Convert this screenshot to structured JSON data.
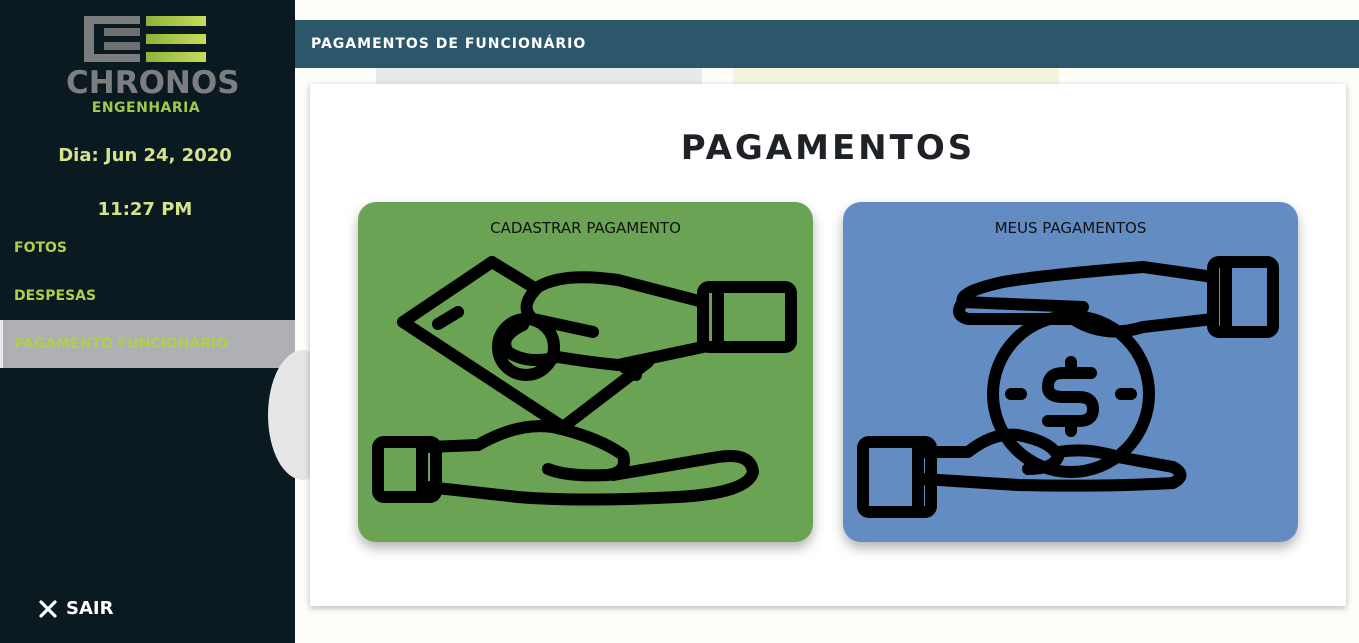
{
  "sidebar": {
    "logo_title": "CHRONOS",
    "logo_subtitle": "ENGENHARIA",
    "date": "Dia: Jun 24, 2020",
    "time": "11:27 PM",
    "nav_items": [
      {
        "label": "FOTOS",
        "active": false
      },
      {
        "label": "DESPESAS",
        "active": false
      },
      {
        "label": "PAGAMENTO FUNCIONÁRIO",
        "active": true
      }
    ],
    "logout_label": "SAIR"
  },
  "header": {
    "title": "PAGAMENTOS DE FUNCIONÁRIO"
  },
  "main": {
    "title": "PAGAMENTOS",
    "cards": [
      {
        "label": "CADASTRAR PAGAMENTO",
        "color": "#6ba354",
        "icon": "money-exchange-hands-icon"
      },
      {
        "label": "MEUS PAGAMENTOS",
        "color": "#638cc3",
        "icon": "coin-between-hands-icon"
      }
    ]
  },
  "colors": {
    "sidebar_bg": "#0b1921",
    "accent_green": "#b3cd4c",
    "header_bg": "#2c576b",
    "active_nav_bg": "#aeb0b3"
  }
}
